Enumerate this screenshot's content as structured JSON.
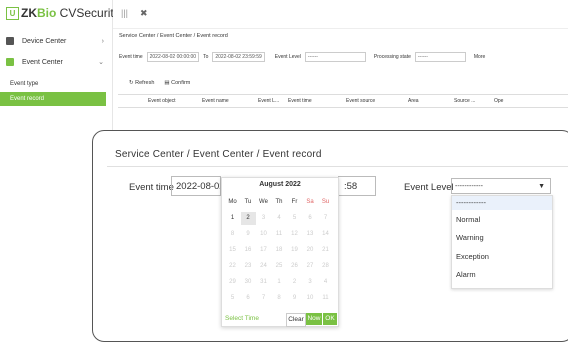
{
  "app": {
    "logo_badge": "U",
    "logo_zk": "ZK",
    "logo_bio": "Bio",
    "logo_rest": " CVSecurity"
  },
  "topbar": {
    "menu_icon": "|||",
    "close_icon": "✖"
  },
  "sidebar": {
    "items": [
      {
        "label": "Device Center",
        "chevron": "›"
      },
      {
        "label": "Event Center",
        "chevron": "⌄"
      }
    ],
    "sub_items": [
      {
        "label": "Event type"
      },
      {
        "label": "Event record"
      }
    ]
  },
  "background": {
    "breadcrumb": "Service Center / Event Center / Event record",
    "event_time_label": "Event time",
    "event_time_from": "2022-08-02 00:00:00",
    "to_label": "To",
    "event_time_to": "2022-08-02 23:59:59",
    "event_level_label": "Event Level",
    "event_level_value": "------",
    "processing_state_label": "Processing state",
    "processing_state_value": "------",
    "more_label": "More",
    "refresh_label": "Refresh",
    "confirm_label": "Confirm",
    "columns": [
      "Event object",
      "Event name",
      "Event L...",
      "Event time",
      "Event source",
      "Area",
      "Source ...",
      "Ope"
    ]
  },
  "zoom": {
    "breadcrumb": "Service Center / Event Center / Event record",
    "event_time_label": "Event time",
    "event_time_from": "2022-08-02",
    "event_time_to_partial": ":58",
    "event_level_label": "Event Level",
    "event_level_value": "------------",
    "level_options": [
      "------------",
      "Normal",
      "Warning",
      "Exception",
      "Alarm"
    ]
  },
  "calendar": {
    "title": "August 2022",
    "dow": [
      "Mo",
      "Tu",
      "We",
      "Th",
      "Fr",
      "Sa",
      "Su"
    ],
    "weeks": [
      [
        "1",
        "2",
        "3",
        "4",
        "5",
        "6",
        "7"
      ],
      [
        "8",
        "9",
        "10",
        "11",
        "12",
        "13",
        "14"
      ],
      [
        "15",
        "16",
        "17",
        "18",
        "19",
        "20",
        "21"
      ],
      [
        "22",
        "23",
        "24",
        "25",
        "26",
        "27",
        "28"
      ],
      [
        "29",
        "30",
        "31",
        "1",
        "2",
        "3",
        "4"
      ],
      [
        "5",
        "6",
        "7",
        "8",
        "9",
        "10",
        "11"
      ]
    ],
    "current_days": [
      "1",
      "2"
    ],
    "selected_day": "2",
    "select_time_label": "Select Time",
    "clear_label": "Clear",
    "now_label": "Now",
    "ok_label": "OK"
  },
  "colors": {
    "accent": "#7ac143",
    "weekend": "#e06666"
  }
}
